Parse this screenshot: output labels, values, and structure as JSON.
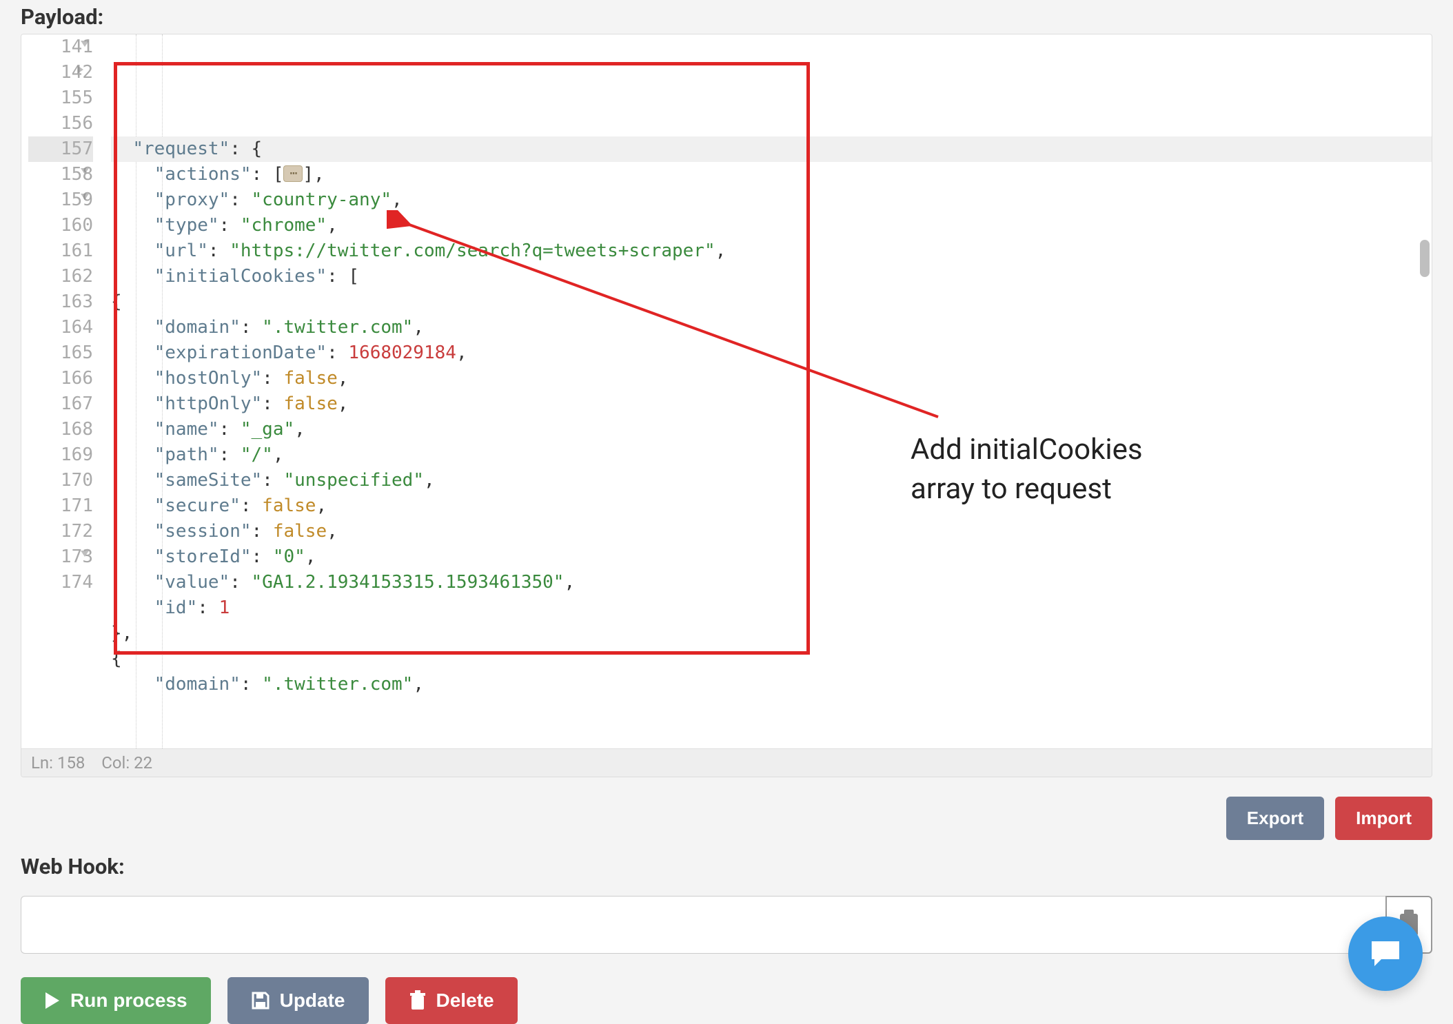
{
  "labels": {
    "payload": "Payload:",
    "webhook": "Web Hook:"
  },
  "editor": {
    "status": {
      "ln_label": "Ln:",
      "ln": "158",
      "col_label": "Col:",
      "col": "22"
    },
    "highlighted_line_index": 4,
    "lines": [
      {
        "num": "141",
        "fold": "open",
        "parts": [
          [
            "p",
            "  "
          ],
          [
            "k",
            "\"request\""
          ],
          [
            "p",
            ": {"
          ]
        ]
      },
      {
        "num": "142",
        "fold": "closed",
        "parts": [
          [
            "p",
            "    "
          ],
          [
            "k",
            "\"actions\""
          ],
          [
            "p",
            ": ["
          ],
          [
            "fold",
            ""
          ],
          [
            "p",
            "],"
          ]
        ]
      },
      {
        "num": "155",
        "fold": "",
        "parts": [
          [
            "p",
            "    "
          ],
          [
            "k",
            "\"proxy\""
          ],
          [
            "p",
            ": "
          ],
          [
            "s",
            "\"country-any\""
          ],
          [
            "p",
            ","
          ]
        ]
      },
      {
        "num": "156",
        "fold": "",
        "parts": [
          [
            "p",
            "    "
          ],
          [
            "k",
            "\"type\""
          ],
          [
            "p",
            ": "
          ],
          [
            "s",
            "\"chrome\""
          ],
          [
            "p",
            ","
          ]
        ]
      },
      {
        "num": "157",
        "fold": "",
        "parts": [
          [
            "p",
            "    "
          ],
          [
            "k",
            "\"url\""
          ],
          [
            "p",
            ": "
          ],
          [
            "s",
            "\"https://twitter.com/search?q=tweets+scraper\""
          ],
          [
            "p",
            ","
          ]
        ]
      },
      {
        "num": "158",
        "fold": "open",
        "parts": [
          [
            "p",
            "    "
          ],
          [
            "k",
            "\"initialCookies\""
          ],
          [
            "p",
            ": ["
          ]
        ]
      },
      {
        "num": "159",
        "fold": "open",
        "parts": [
          [
            "p",
            "{"
          ]
        ]
      },
      {
        "num": "160",
        "fold": "",
        "parts": [
          [
            "p",
            "    "
          ],
          [
            "k",
            "\"domain\""
          ],
          [
            "p",
            ": "
          ],
          [
            "s",
            "\".twitter.com\""
          ],
          [
            "p",
            ","
          ]
        ]
      },
      {
        "num": "161",
        "fold": "",
        "parts": [
          [
            "p",
            "    "
          ],
          [
            "k",
            "\"expirationDate\""
          ],
          [
            "p",
            ": "
          ],
          [
            "n",
            "1668029184"
          ],
          [
            "p",
            ","
          ]
        ]
      },
      {
        "num": "162",
        "fold": "",
        "parts": [
          [
            "p",
            "    "
          ],
          [
            "k",
            "\"hostOnly\""
          ],
          [
            "p",
            ": "
          ],
          [
            "b",
            "false"
          ],
          [
            "p",
            ","
          ]
        ]
      },
      {
        "num": "163",
        "fold": "",
        "parts": [
          [
            "p",
            "    "
          ],
          [
            "k",
            "\"httpOnly\""
          ],
          [
            "p",
            ": "
          ],
          [
            "b",
            "false"
          ],
          [
            "p",
            ","
          ]
        ]
      },
      {
        "num": "164",
        "fold": "",
        "parts": [
          [
            "p",
            "    "
          ],
          [
            "k",
            "\"name\""
          ],
          [
            "p",
            ": "
          ],
          [
            "s",
            "\"_ga\""
          ],
          [
            "p",
            ","
          ]
        ]
      },
      {
        "num": "165",
        "fold": "",
        "parts": [
          [
            "p",
            "    "
          ],
          [
            "k",
            "\"path\""
          ],
          [
            "p",
            ": "
          ],
          [
            "s",
            "\"/\""
          ],
          [
            "p",
            ","
          ]
        ]
      },
      {
        "num": "166",
        "fold": "",
        "parts": [
          [
            "p",
            "    "
          ],
          [
            "k",
            "\"sameSite\""
          ],
          [
            "p",
            ": "
          ],
          [
            "s",
            "\"unspecified\""
          ],
          [
            "p",
            ","
          ]
        ]
      },
      {
        "num": "167",
        "fold": "",
        "parts": [
          [
            "p",
            "    "
          ],
          [
            "k",
            "\"secure\""
          ],
          [
            "p",
            ": "
          ],
          [
            "b",
            "false"
          ],
          [
            "p",
            ","
          ]
        ]
      },
      {
        "num": "168",
        "fold": "",
        "parts": [
          [
            "p",
            "    "
          ],
          [
            "k",
            "\"session\""
          ],
          [
            "p",
            ": "
          ],
          [
            "b",
            "false"
          ],
          [
            "p",
            ","
          ]
        ]
      },
      {
        "num": "169",
        "fold": "",
        "parts": [
          [
            "p",
            "    "
          ],
          [
            "k",
            "\"storeId\""
          ],
          [
            "p",
            ": "
          ],
          [
            "s",
            "\"0\""
          ],
          [
            "p",
            ","
          ]
        ]
      },
      {
        "num": "170",
        "fold": "",
        "parts": [
          [
            "p",
            "    "
          ],
          [
            "k",
            "\"value\""
          ],
          [
            "p",
            ": "
          ],
          [
            "s",
            "\"GA1.2.1934153315.1593461350\""
          ],
          [
            "p",
            ","
          ]
        ]
      },
      {
        "num": "171",
        "fold": "",
        "parts": [
          [
            "p",
            "    "
          ],
          [
            "k",
            "\"id\""
          ],
          [
            "p",
            ": "
          ],
          [
            "n",
            "1"
          ]
        ]
      },
      {
        "num": "172",
        "fold": "",
        "parts": [
          [
            "p",
            "},"
          ]
        ]
      },
      {
        "num": "173",
        "fold": "open",
        "parts": [
          [
            "p",
            "{"
          ]
        ]
      },
      {
        "num": "174",
        "fold": "",
        "parts": [
          [
            "p",
            "    "
          ],
          [
            "k",
            "\"domain\""
          ],
          [
            "p",
            ": "
          ],
          [
            "s",
            "\".twitter.com\""
          ],
          [
            "p",
            ","
          ]
        ]
      }
    ]
  },
  "annotation": {
    "line1": "Add initialCookies",
    "line2": "array to request"
  },
  "buttons": {
    "export": "Export",
    "import": "Import",
    "run": "Run process",
    "update": "Update",
    "delete": "Delete"
  }
}
